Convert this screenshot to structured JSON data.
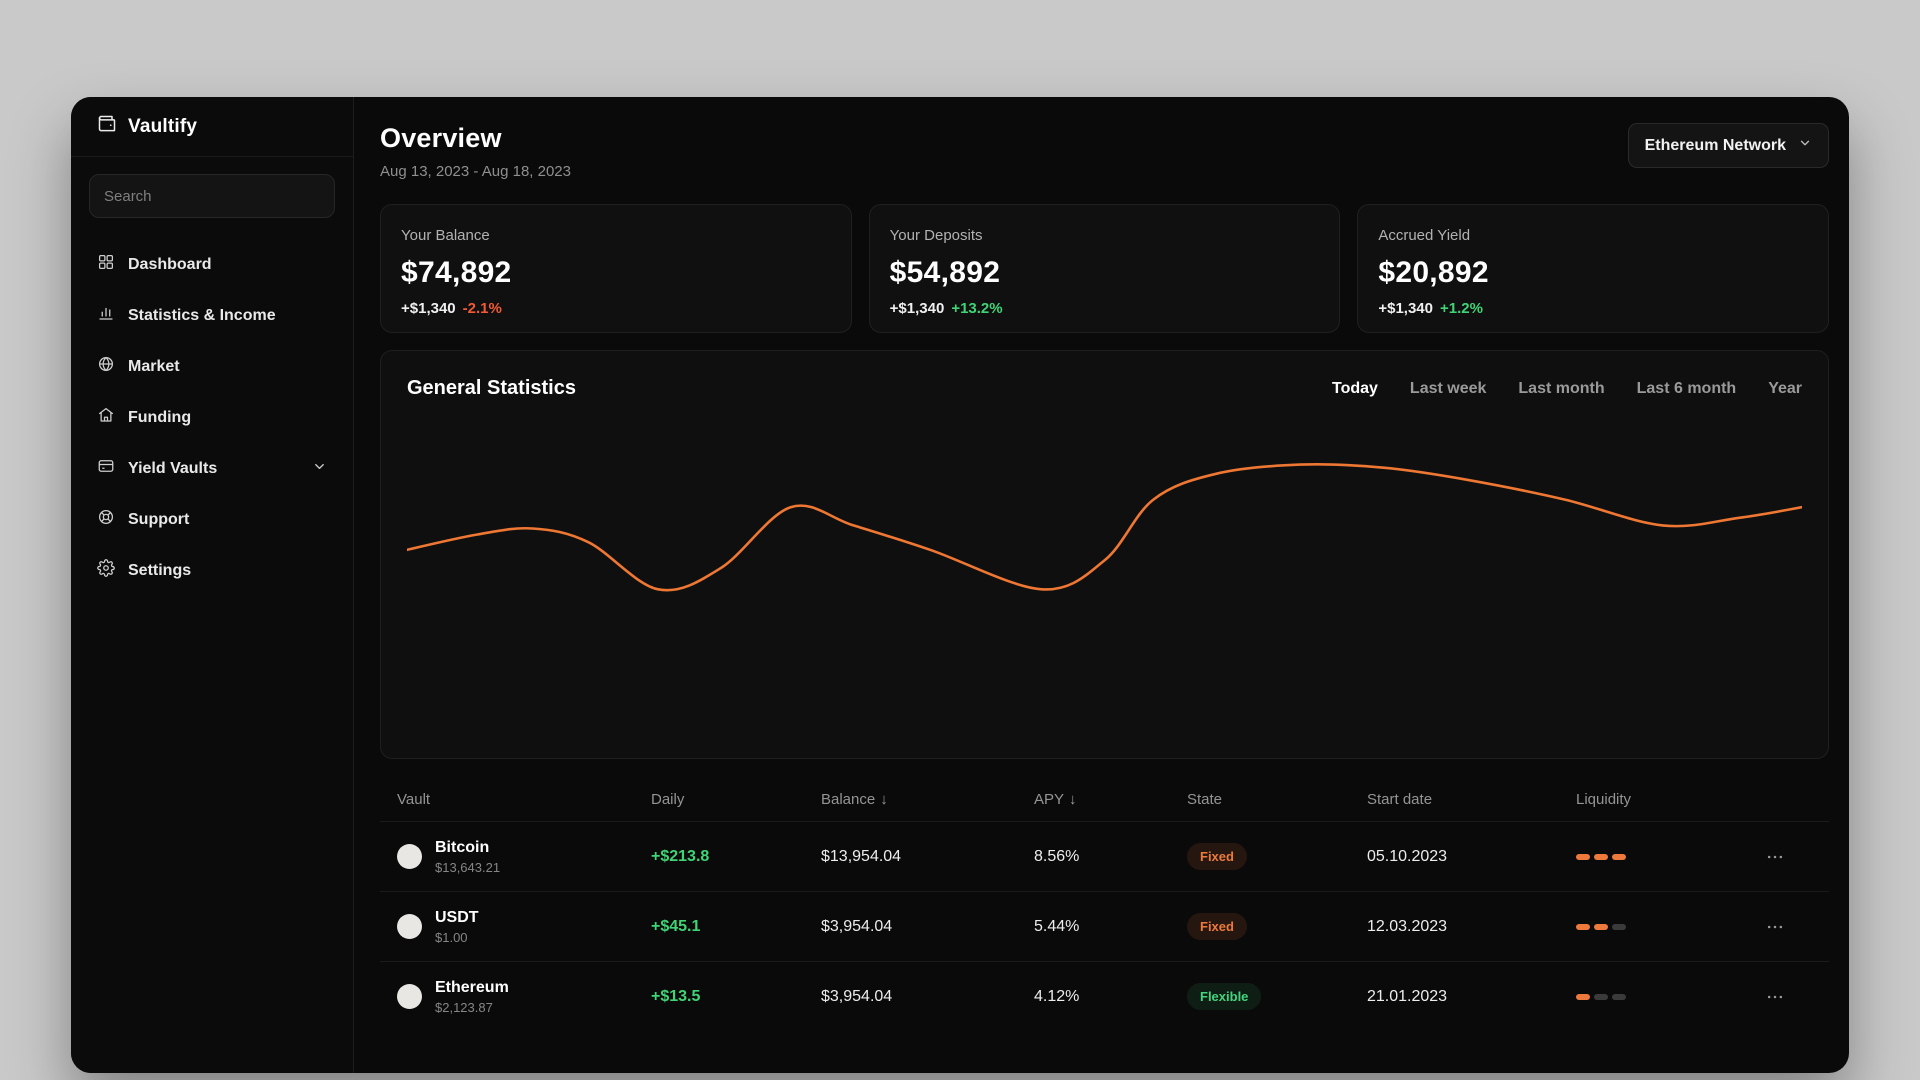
{
  "app": {
    "name": "Vaultify"
  },
  "colors": {
    "accent_orange": "#ee7733",
    "positive_green": "#3fd476",
    "negative_red": "#f25a33"
  },
  "sidebar": {
    "search": {
      "placeholder": "Search"
    },
    "items": [
      {
        "label": "Dashboard",
        "icon": "dashboard-grid-icon"
      },
      {
        "label": "Statistics & Income",
        "icon": "statistics-icon"
      },
      {
        "label": "Market",
        "icon": "globe-icon"
      },
      {
        "label": "Funding",
        "icon": "funding-icon"
      },
      {
        "label": "Yield Vaults",
        "icon": "vault-icon",
        "has_chevron": true
      },
      {
        "label": "Support",
        "icon": "support-icon"
      },
      {
        "label": "Settings",
        "icon": "gear-icon"
      }
    ]
  },
  "header": {
    "title": "Overview",
    "date_range": "Aug 13, 2023 - Aug 18, 2023",
    "network_button": "Ethereum Network"
  },
  "stat_cards": [
    {
      "label": "Your Balance",
      "value": "$74,892",
      "change": "+$1,340",
      "percent": "-2.1%",
      "trend": "down"
    },
    {
      "label": "Your Deposits",
      "value": "$54,892",
      "change": "+$1,340",
      "percent": "+13.2%",
      "trend": "up"
    },
    {
      "label": "Accrued Yield",
      "value": "$20,892",
      "change": "+$1,340",
      "percent": "+1.2%",
      "trend": "up"
    }
  ],
  "statistics_panel": {
    "title": "General Statistics",
    "tabs": [
      {
        "label": "Today",
        "active": true
      },
      {
        "label": "Last week",
        "active": false
      },
      {
        "label": "Last month",
        "active": false
      },
      {
        "label": "Last 6 month",
        "active": false
      },
      {
        "label": "Year",
        "active": false
      }
    ]
  },
  "chart_data": {
    "type": "line",
    "title": "General Statistics",
    "xlabel": "",
    "ylabel": "",
    "axes_labeled": false,
    "grid": false,
    "legend": false,
    "line_color": "#ee7733",
    "x_range": [
      0,
      100
    ],
    "y_range": [
      0,
      100
    ],
    "series": [
      {
        "name": "balance-curve",
        "points_pct": [
          [
            0,
            37
          ],
          [
            5,
            47
          ],
          [
            9,
            51
          ],
          [
            13,
            42
          ],
          [
            18,
            11
          ],
          [
            22.5,
            25
          ],
          [
            27.5,
            65
          ],
          [
            32,
            53
          ],
          [
            37.5,
            37
          ],
          [
            45.5,
            11
          ],
          [
            50,
            30
          ],
          [
            53.5,
            70
          ],
          [
            58,
            87
          ],
          [
            64,
            93
          ],
          [
            70,
            91
          ],
          [
            76,
            83
          ],
          [
            83,
            70
          ],
          [
            90,
            53
          ],
          [
            95.5,
            58
          ],
          [
            100,
            65
          ]
        ]
      }
    ]
  },
  "table": {
    "columns": [
      {
        "label": "Vault",
        "sortable": false
      },
      {
        "label": "Daily",
        "sortable": false
      },
      {
        "label": "Balance",
        "sortable": true
      },
      {
        "label": "APY",
        "sortable": true
      },
      {
        "label": "State",
        "sortable": false
      },
      {
        "label": "Start date",
        "sortable": false
      },
      {
        "label": "Liquidity",
        "sortable": false
      }
    ],
    "sort_arrow": "↓",
    "rows": [
      {
        "name": "Bitcoin",
        "price": "$13,643.21",
        "daily": "+$213.8",
        "balance": "$13,954.04",
        "apy": "8.56%",
        "state": "Fixed",
        "start_date": "05.10.2023",
        "liquidity": 3
      },
      {
        "name": "USDT",
        "price": "$1.00",
        "daily": "+$45.1",
        "balance": "$3,954.04",
        "apy": "5.44%",
        "state": "Fixed",
        "start_date": "12.03.2023",
        "liquidity": 2
      },
      {
        "name": "Ethereum",
        "price": "$2,123.87",
        "daily": "+$13.5",
        "balance": "$3,954.04",
        "apy": "4.12%",
        "state": "Flexible",
        "start_date": "21.01.2023",
        "liquidity": 1
      }
    ]
  }
}
